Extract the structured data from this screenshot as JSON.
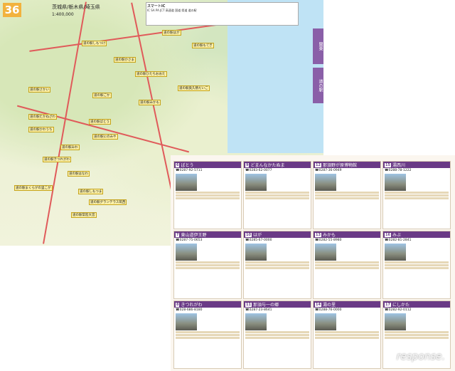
{
  "page_number": "36",
  "map": {
    "title": "茨城県/栃木県/埼玉県",
    "scale": "1:400,000",
    "legend_title": "スマートIC",
    "legend_items": [
      "IC",
      "SA",
      "PA",
      "JCT",
      "高速道",
      "国道",
      "県道",
      "道の駅"
    ],
    "side_tabs": [
      "関東",
      "道の駅"
    ],
    "labels": [
      "道の駅はが",
      "道の駅もてぎ",
      "道の駅しもつけ",
      "道の駅かさま",
      "道の駅ひたちおおた",
      "道の駅さかい",
      "道の駅ごか",
      "道の駅みかも",
      "道の駅たかねざわ",
      "道の駅ばとう",
      "道の駅かわうち",
      "道の駅にのみや",
      "道の駅みわ",
      "道の駅きつれがわ",
      "道の駅はなわ",
      "道の駅まくらがの里こが",
      "道の駅しもつま",
      "道の駅グランテラス筑西",
      "道の駅常陸大宮",
      "道の駅奥久慈だいご"
    ]
  },
  "cards": [
    {
      "n": "6",
      "name": "ばとう",
      "tel": "☎0287-92-5711"
    },
    {
      "n": "9",
      "name": "どまんなかたぬま",
      "tel": "☎0283-62-0077"
    },
    {
      "n": "12",
      "name": "那須野が原博物館",
      "tel": "☎0287-36-0949"
    },
    {
      "n": "15",
      "name": "湯西川",
      "tel": "☎0288-78-1222"
    },
    {
      "n": "7",
      "name": "東山道伊王野",
      "tel": "☎0287-75-0653"
    },
    {
      "n": "10",
      "name": "はが",
      "tel": "☎0285-67-0000"
    },
    {
      "n": "13",
      "name": "みかも",
      "tel": "☎0282-55-8980"
    },
    {
      "n": "16",
      "name": "みぶ",
      "tel": "☎0282-81-2841"
    },
    {
      "n": "8",
      "name": "きつれがわ",
      "tel": "☎028-686-8180"
    },
    {
      "n": "11",
      "name": "那須与一の郷",
      "tel": "☎0287-23-8641"
    },
    {
      "n": "14",
      "name": "湯の里",
      "tel": "☎0288-76-0000"
    },
    {
      "n": "17",
      "name": "にしかた",
      "tel": "☎0282-92-0112"
    }
  ],
  "watermark": "response."
}
